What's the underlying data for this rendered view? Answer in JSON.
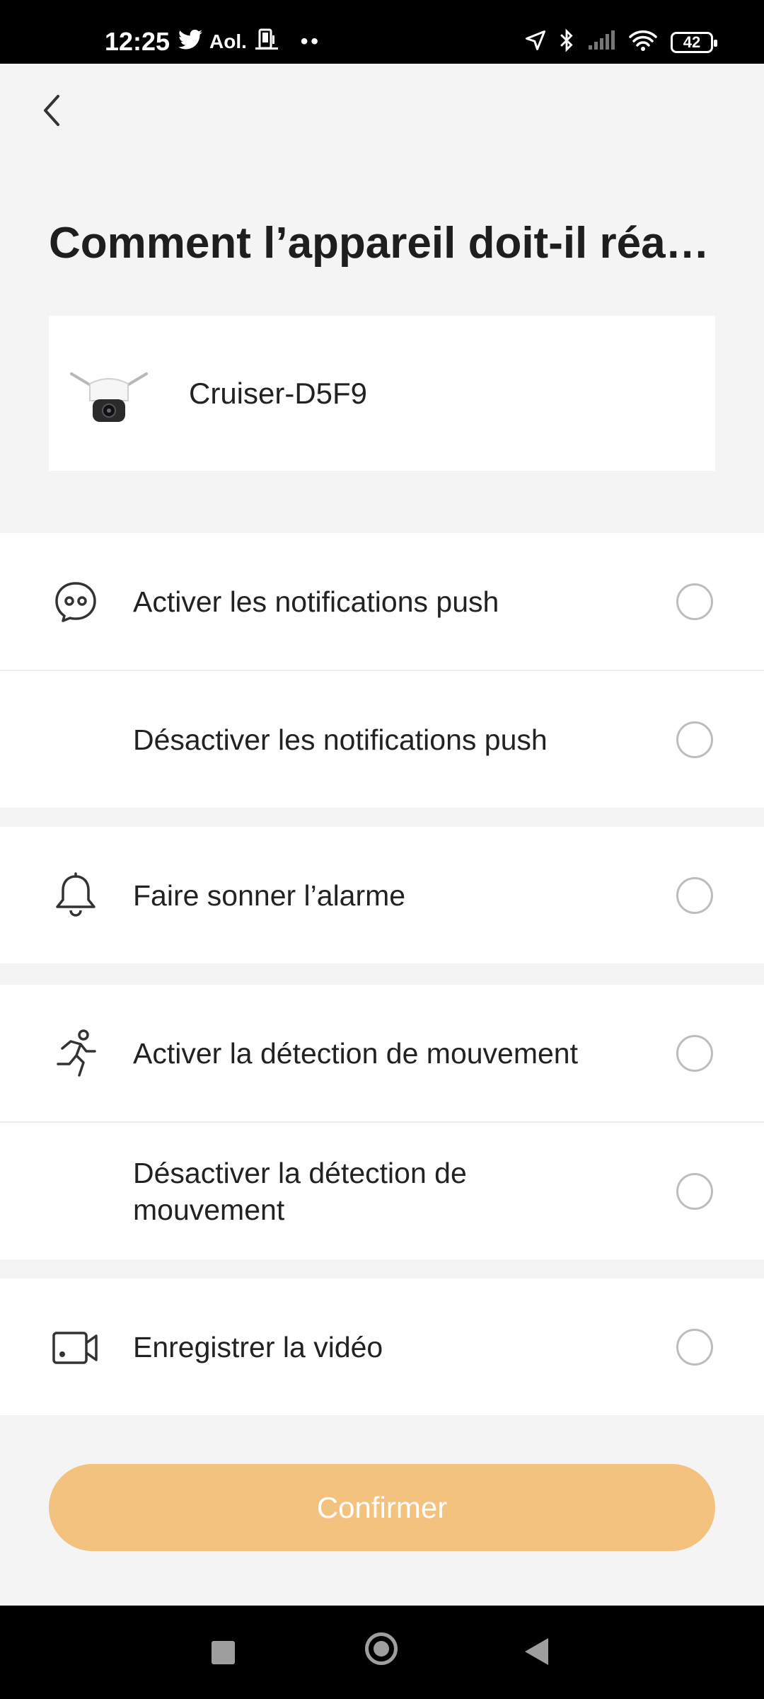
{
  "status_bar": {
    "time": "12:25",
    "left_icons": [
      "twitter-icon",
      "aol-label",
      "phone-card-icon",
      "more-dots"
    ],
    "aol_label": "Aol.",
    "dots": "••",
    "right_icons": [
      "location-icon",
      "bluetooth-icon",
      "signal-icon",
      "wifi-icon",
      "battery-icon"
    ],
    "battery": "42"
  },
  "header": {
    "back_icon": "chevron-left-icon",
    "title": "Comment l’appareil doit-il réagi…"
  },
  "device": {
    "name": "Cruiser-D5F9",
    "thumbnail": "security-camera-image"
  },
  "options": {
    "group1": [
      {
        "label": "Activer les notifications push",
        "icon": "chat-bubble-icon",
        "selected": false
      },
      {
        "label": "Désactiver les notifications push",
        "icon": "",
        "selected": false
      }
    ],
    "group2": [
      {
        "label": "Faire sonner l’alarme",
        "icon": "bell-icon",
        "selected": false
      }
    ],
    "group3": [
      {
        "label": "Activer la détection de mouvement",
        "icon": "running-person-icon",
        "selected": false
      },
      {
        "label": "Désactiver la détection de mouvement",
        "icon": "",
        "selected": false
      }
    ],
    "group4": [
      {
        "label": "Enregistrer la vidéo",
        "icon": "video-camera-icon",
        "selected": false
      }
    ]
  },
  "confirm": {
    "label": "Confirmer",
    "color": "#f3c27e",
    "enabled": false
  },
  "nav": [
    "recents-square-icon",
    "home-circle-icon",
    "back-triangle-icon"
  ],
  "colors": {
    "background": "#f4f4f4",
    "accent": "#f3c27e",
    "radio_border": "#bdbdbd"
  }
}
